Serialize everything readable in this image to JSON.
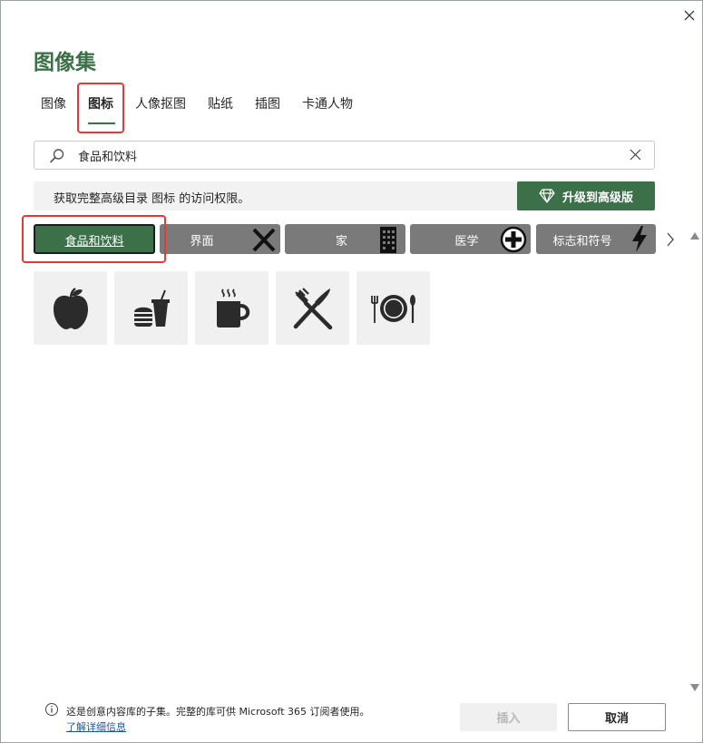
{
  "dialog": {
    "title": "图像集",
    "close_icon": "close-icon"
  },
  "tabs": [
    {
      "label": "图像"
    },
    {
      "label": "图标",
      "active": true
    },
    {
      "label": "人像抠图"
    },
    {
      "label": "贴纸"
    },
    {
      "label": "插图"
    },
    {
      "label": "卡通人物"
    }
  ],
  "search": {
    "value": "食品和饮料",
    "icon": "search-icon",
    "clear_icon": "clear-icon"
  },
  "promo": {
    "text": "获取完整高级目录 图标 的访问权限。",
    "upgrade_label": "升级到高级版",
    "upgrade_icon": "diamond-icon"
  },
  "categories": [
    {
      "label": "食品和饮料",
      "active": true
    },
    {
      "label": "界面",
      "icon": "x-icon"
    },
    {
      "label": "家",
      "icon": "building-icon"
    },
    {
      "label": "医学",
      "icon": "medical-plus-icon"
    },
    {
      "label": "标志和符号",
      "icon": "lightning-icon"
    }
  ],
  "icons": [
    {
      "name": "apple-icon"
    },
    {
      "name": "fast-food-icon"
    },
    {
      "name": "coffee-cup-icon"
    },
    {
      "name": "fork-knife-icon"
    },
    {
      "name": "plate-cutlery-icon"
    }
  ],
  "colors": {
    "accent": "#3b7049",
    "category_bg": "#7a7a7a",
    "highlight": "#e03a3a"
  },
  "footer": {
    "info_text": "这是创意内容库的子集。完整的库可供 Microsoft 365 订阅者使用。",
    "link_text": "了解详细信息",
    "insert_label": "插入",
    "cancel_label": "取消"
  }
}
